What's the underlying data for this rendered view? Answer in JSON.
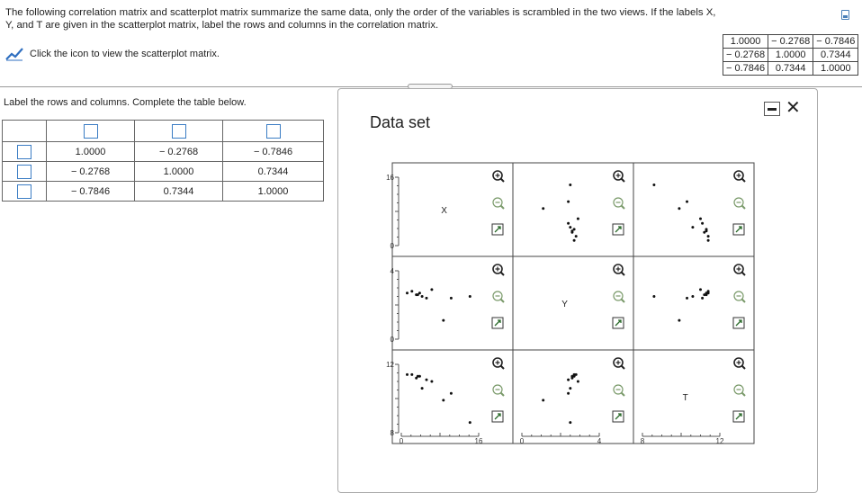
{
  "question": {
    "text": "The following correlation matrix and scatterplot matrix summarize the same data, only the order of the variables is scrambled in the two views. If the labels X, Y, and T are given in the scatterplot matrix, label the rows and columns in the correlation matrix.",
    "link_text": "Click the icon to view the scatterplot matrix.",
    "corr_matrix": [
      [
        "1.0000",
        "− 0.2768",
        "− 0.7846"
      ],
      [
        "− 0.2768",
        "1.0000",
        "0.7344"
      ],
      [
        "− 0.7846",
        "0.7344",
        "1.0000"
      ]
    ]
  },
  "answer": {
    "instructions": "Label the rows and columns. Complete the table below.",
    "rows": [
      [
        "1.0000",
        "− 0.2768",
        "− 0.7846"
      ],
      [
        "− 0.2768",
        "1.0000",
        "0.7344"
      ],
      [
        "− 0.7846",
        "0.7344",
        "1.0000"
      ]
    ]
  },
  "panel": {
    "title": "Data set",
    "minimize_icon": "minimize-icon",
    "close_icon": "close-icon",
    "close_glyph": "✕"
  },
  "chart_data": {
    "type": "scatter",
    "variables": [
      "X",
      "Y",
      "T"
    ],
    "diagonal_labels": [
      "X",
      "Y",
      "T"
    ],
    "left_axis_ticks": [
      {
        "min": "0",
        "max": "16"
      },
      {
        "min": "0",
        "max": "4"
      },
      {
        "min": "8",
        "max": "12"
      }
    ],
    "bottom_axis_ticks": [
      {
        "min": "0",
        "max": "16"
      },
      {
        "min": "0",
        "max": "4"
      },
      {
        "min": "8",
        "max": "12"
      }
    ],
    "ranges": {
      "X": [
        0,
        16
      ],
      "Y": [
        0,
        4
      ],
      "T": [
        8,
        12
      ]
    },
    "points": {
      "X": [
        1.2,
        2.2,
        3.1,
        3.4,
        3.8,
        4.3,
        5.2,
        6.3,
        8.7,
        10.3,
        14.2
      ],
      "Y": [
        2.7,
        2.8,
        2.6,
        2.6,
        2.7,
        2.5,
        2.4,
        2.9,
        1.1,
        2.4,
        2.5
      ],
      "T": [
        11.4,
        11.4,
        11.2,
        11.3,
        11.3,
        10.6,
        11.1,
        11.0,
        9.9,
        10.3,
        8.6
      ]
    },
    "buttons": [
      "zoom-in-icon",
      "zoom-out-icon",
      "expand-icon"
    ]
  }
}
